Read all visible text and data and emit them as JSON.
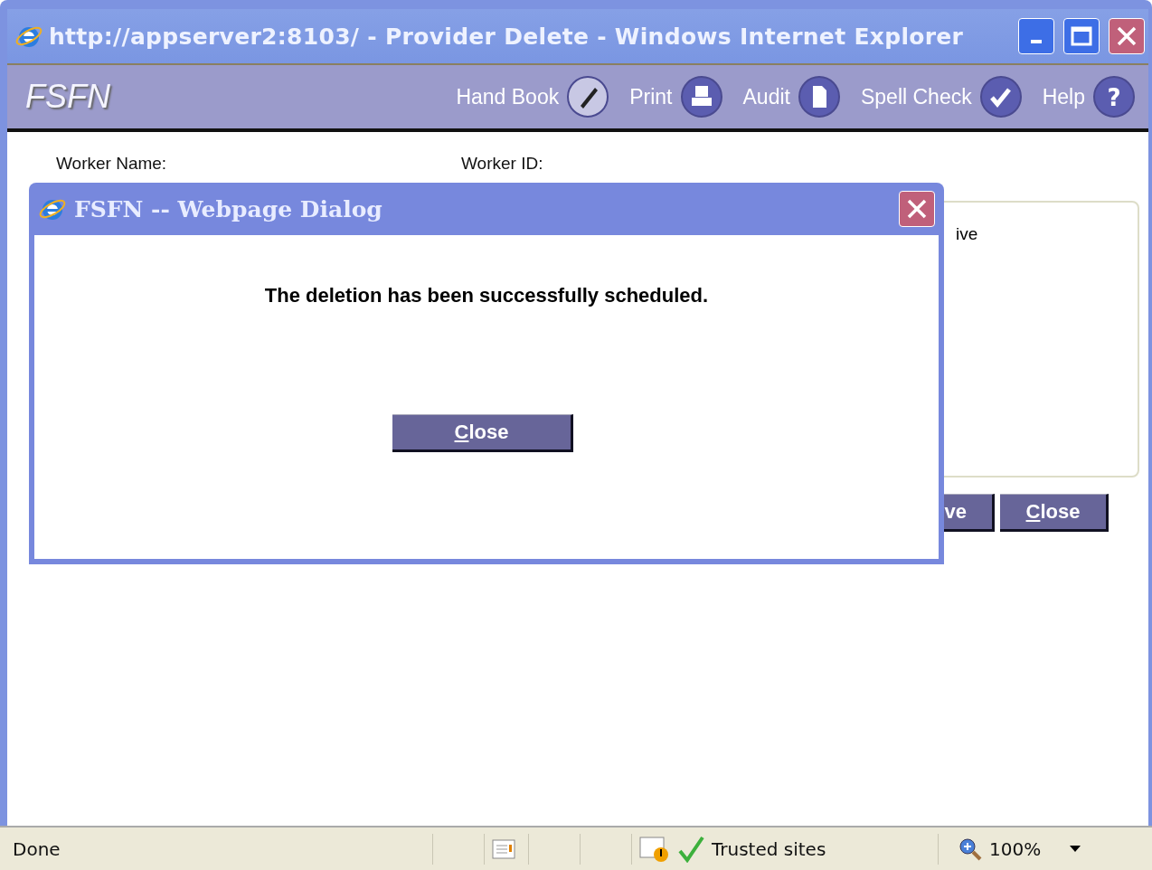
{
  "window": {
    "title": "http://appserver2:8103/ - Provider Delete - Windows Internet Explorer"
  },
  "app_header": {
    "logo": "FSFN",
    "tools": [
      {
        "label": "Hand Book",
        "kind": "pen"
      },
      {
        "label": "Print",
        "kind": "print"
      },
      {
        "label": "Audit",
        "kind": "document"
      },
      {
        "label": "Spell Check",
        "kind": "spell"
      },
      {
        "label": "Help",
        "kind": "help",
        "icon_text": "?"
      }
    ]
  },
  "page": {
    "fields": [
      "Worker Name:",
      "Worker ID:"
    ],
    "panel_text": "ive",
    "buttons": [
      {
        "label": "ve",
        "underline_first": false
      },
      {
        "label": "Close",
        "underline_first": true
      }
    ]
  },
  "dialog": {
    "title": "FSFN -- Webpage Dialog",
    "message": "The deletion has been successfully scheduled.",
    "button": {
      "label": "Close",
      "underline_first": true
    }
  },
  "status_bar": {
    "status": "Done",
    "zone": "Trusted sites",
    "zoom": "100%"
  }
}
